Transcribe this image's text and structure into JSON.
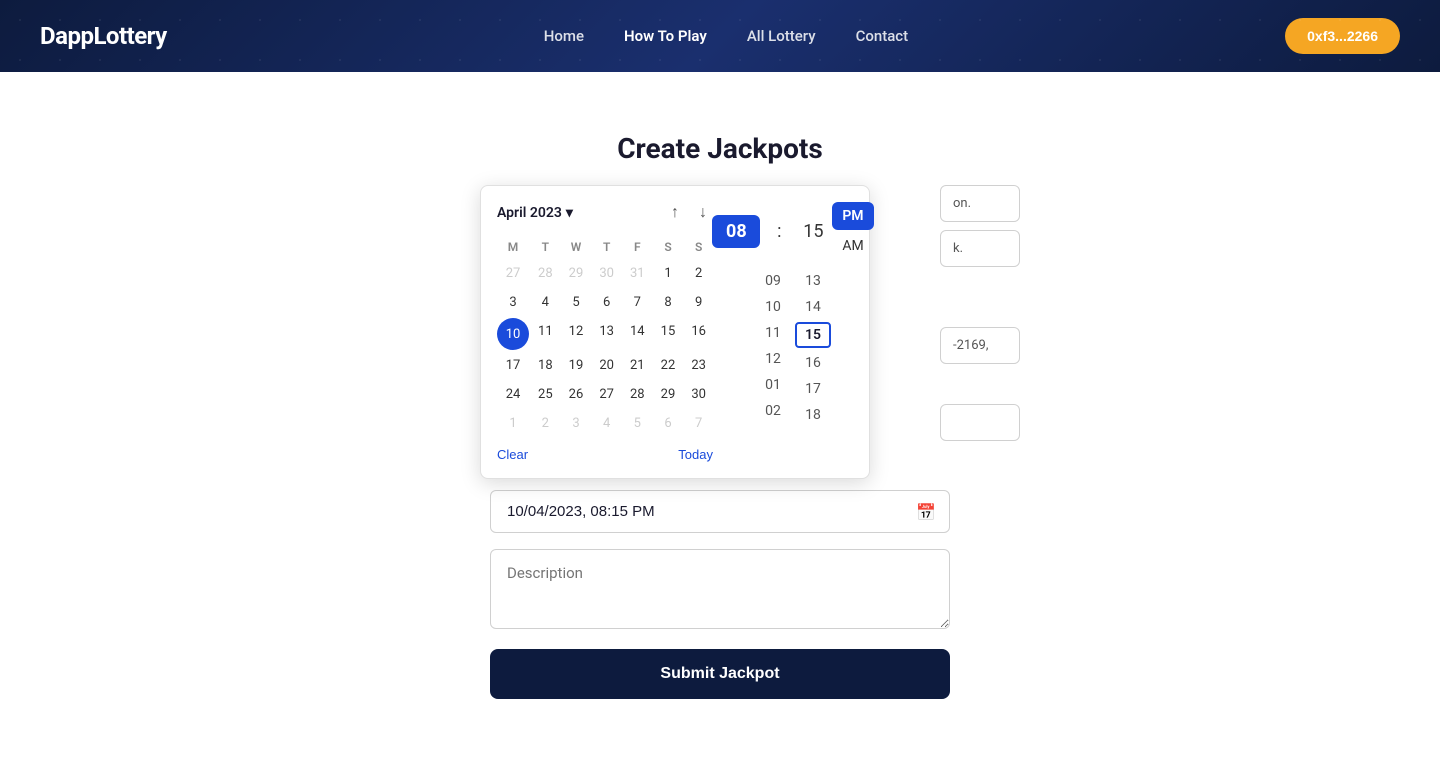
{
  "nav": {
    "brand": "DappLottery",
    "links": [
      {
        "label": "Home",
        "active": false
      },
      {
        "label": "How To Play",
        "active": true
      },
      {
        "label": "All Lottery",
        "active": false
      },
      {
        "label": "Contact",
        "active": false
      }
    ],
    "wallet_button": "0xf3...2266"
  },
  "page": {
    "title": "Create Jackpots"
  },
  "calendar": {
    "month_label": "April 2023",
    "chevron": "▾",
    "days_of_week": [
      "M",
      "T",
      "W",
      "T",
      "F",
      "S",
      "S"
    ],
    "prev_arrow": "↑",
    "next_arrow": "↓",
    "rows": [
      [
        "27",
        "28",
        "29",
        "30",
        "31",
        "1",
        "2"
      ],
      [
        "3",
        "4",
        "5",
        "6",
        "7",
        "8",
        "9"
      ],
      [
        "10",
        "11",
        "12",
        "13",
        "14",
        "15",
        "16"
      ],
      [
        "17",
        "18",
        "19",
        "20",
        "21",
        "22",
        "23"
      ],
      [
        "24",
        "25",
        "26",
        "27",
        "28",
        "29",
        "30"
      ],
      [
        "1",
        "2",
        "3",
        "4",
        "5",
        "6",
        "7"
      ]
    ],
    "other_month_first_row": [
      true,
      true,
      true,
      true,
      true,
      false,
      false
    ],
    "other_month_last_row": [
      false,
      false,
      false,
      false,
      false,
      false,
      false
    ],
    "selected_day": "10",
    "selected_row": 2,
    "selected_col": 0,
    "clear_label": "Clear",
    "today_label": "Today"
  },
  "time_picker": {
    "selected_hour": "08",
    "separator": ":",
    "selected_minute": "15",
    "am_label": "AM",
    "pm_label": "PM",
    "pm_selected": true,
    "hour_values": [
      "09",
      "10",
      "11",
      "12",
      "01",
      "02"
    ],
    "minute_values": [
      "13",
      "14",
      "15",
      "16",
      "17",
      "18"
    ],
    "focused_hour_val": null,
    "focused_minute_val": "15"
  },
  "datetime_input": {
    "value": "10/04/2023, 08:15 PM",
    "selected_part": "10"
  },
  "description": {
    "placeholder": "Description"
  },
  "submit_button": {
    "label": "Submit Jackpot"
  },
  "right_partial_fields": {
    "field1": "on.",
    "field2": "k.",
    "field3": "-2169,",
    "field4": ""
  }
}
